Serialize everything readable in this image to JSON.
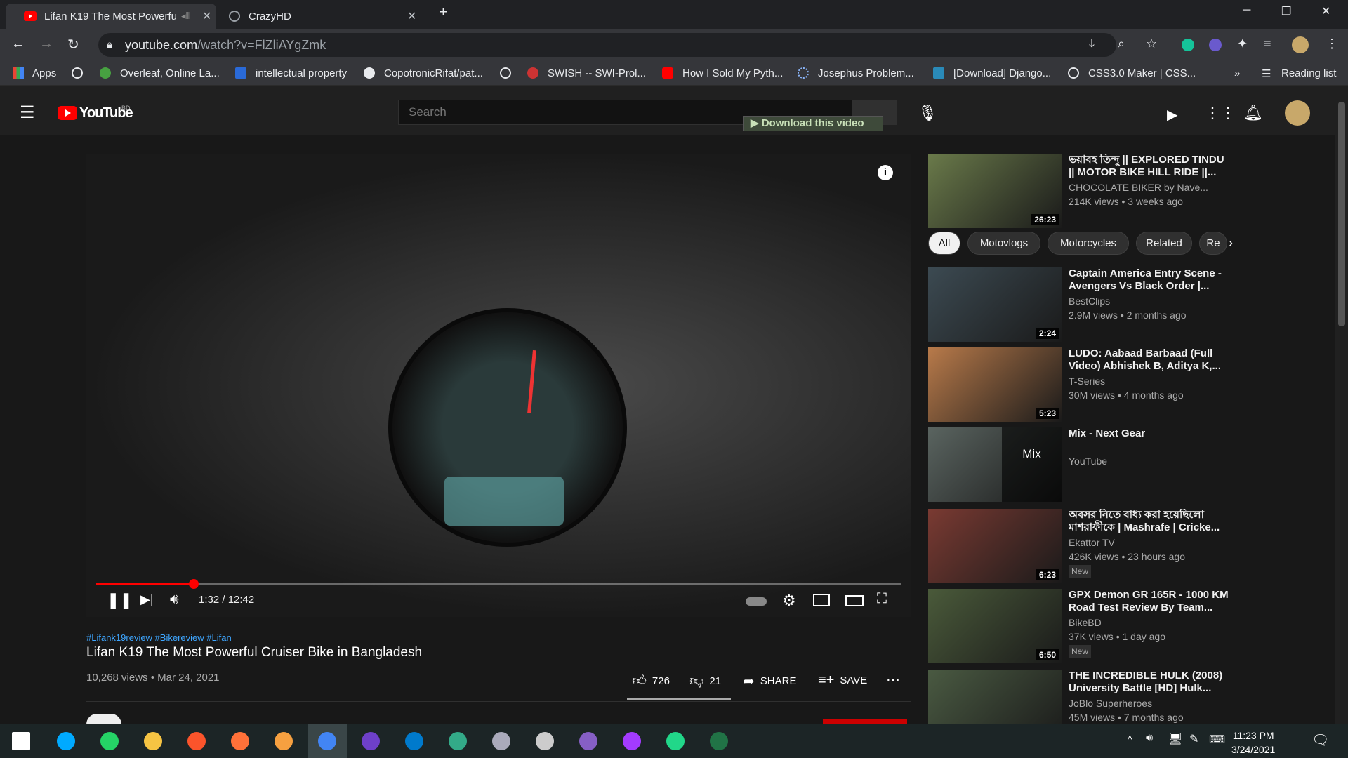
{
  "tabs": [
    {
      "title": "Lifan K19 The Most Powerful",
      "active": true
    },
    {
      "title": "CrazyHD",
      "active": false
    }
  ],
  "address": {
    "url_host": "youtube.com",
    "url_path": "/watch?v=FlZliAYgZmk"
  },
  "bookmarks": [
    "Apps",
    "Overleaf, Online La...",
    "intellectual property",
    "CopotronicRifat/pat...",
    "SWISH -- SWI-Prol...",
    "How I Sold My Pyth...",
    "Josephus Problem...",
    "[Download] Django...",
    "CSS3.0 Maker | CSS..."
  ],
  "reading_list": "Reading list",
  "youtube": {
    "logo": "YouTube",
    "country": "BD",
    "search_placeholder": "Search",
    "download_btn": "Download this video"
  },
  "video": {
    "time": "1:32 / 12:42",
    "progress": 0.121,
    "tags": "#Lifank19review #Bikereview #Lifan",
    "title": "Lifan K19 The Most Powerful Cruiser Bike in Bangladesh",
    "meta": "10,268 views • Mar 24, 2021",
    "likes": "726",
    "dislikes": "21",
    "share": "SHARE",
    "save": "SAVE"
  },
  "chips": [
    "All",
    "Motovlogs",
    "Motorcycles",
    "Related",
    "Re"
  ],
  "recommendations": [
    {
      "title": "ভয়াবহ তিন্দু || EXPLORED TINDU || MOTOR BIKE HILL RIDE ||...",
      "channel": "CHOCOLATE BIKER by Nave...",
      "stats": "214K views • 3 weeks ago",
      "duration": "26:23",
      "color": "#6a7a4a"
    },
    {
      "title": "Captain America Entry Scene - Avengers Vs Black Order |...",
      "channel": "BestClips",
      "stats": "2.9M views • 2 months ago",
      "duration": "2:24",
      "color": "#3c4a52"
    },
    {
      "title": "LUDO: Aabaad Barbaad (Full Video) Abhishek B, Aditya K,...",
      "channel": "T-Series",
      "stats": "30M views • 4 months ago",
      "duration": "5:23",
      "color": "#b87a4a"
    },
    {
      "title": "Mix - Next Gear",
      "channel": "YouTube",
      "stats": "",
      "duration": "",
      "color": "#5a6460",
      "mix": "Mix"
    },
    {
      "title": "অবসর নিতে বাধ্য করা হয়েছিলো মাশরাফীকে | Mashrafe | Cricke...",
      "channel": "Ekattor TV",
      "stats": "426K views • 23 hours ago",
      "duration": "6:23",
      "color": "#7a3a32",
      "badge": "New"
    },
    {
      "title": "GPX Demon GR 165R - 1000 KM Road Test Review By Team...",
      "channel": "BikeBD",
      "stats": "37K views • 1 day ago",
      "duration": "6:50",
      "color": "#4a5a3a",
      "badge": "New"
    },
    {
      "title": "THE INCREDIBLE HULK (2008) University Battle [HD] Hulk...",
      "channel": "JoBlo Superheroes",
      "stats": "45M views • 7 months ago",
      "duration": "",
      "color": "#4a5a42"
    }
  ],
  "clock": {
    "time": "11:23 PM",
    "date": "3/24/2021"
  }
}
